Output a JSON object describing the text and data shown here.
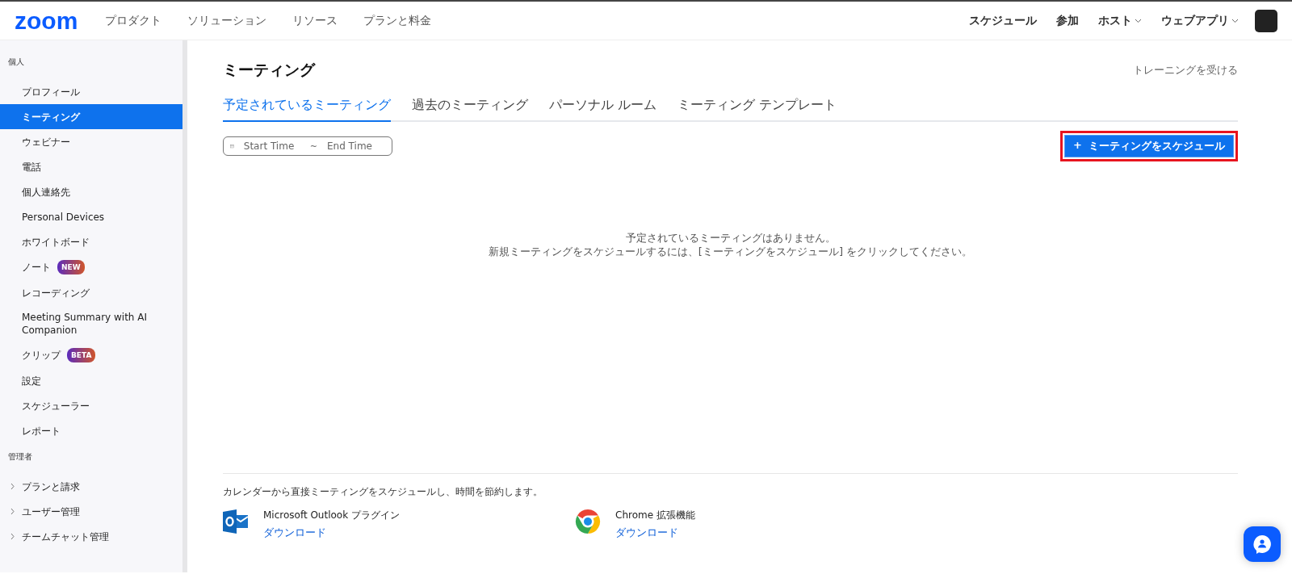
{
  "header": {
    "logo": "zoom",
    "nav": [
      "プロダクト",
      "ソリューション",
      "リソース",
      "プランと料金"
    ],
    "right_nav": [
      {
        "label": "スケジュール",
        "dropdown": false
      },
      {
        "label": "参加",
        "dropdown": false
      },
      {
        "label": "ホスト",
        "dropdown": true
      },
      {
        "label": "ウェブアプリ",
        "dropdown": true
      }
    ]
  },
  "sidebar": {
    "sections": [
      {
        "title": "個人",
        "items": [
          {
            "label": "プロフィール",
            "selected": false
          },
          {
            "label": "ミーティング",
            "selected": true
          },
          {
            "label": "ウェビナー",
            "selected": false
          },
          {
            "label": "電話",
            "selected": false
          },
          {
            "label": "個人連絡先",
            "selected": false
          },
          {
            "label": "Personal Devices",
            "selected": false
          },
          {
            "label": "ホワイトボード",
            "selected": false
          },
          {
            "label": "ノート",
            "selected": false,
            "badge": "NEW"
          },
          {
            "label": "レコーディング",
            "selected": false
          },
          {
            "label": "Meeting Summary with AI Companion",
            "selected": false
          },
          {
            "label": "クリップ",
            "selected": false,
            "badge": "BETA"
          },
          {
            "label": "設定",
            "selected": false
          },
          {
            "label": "スケジューラー",
            "selected": false
          },
          {
            "label": "レポート",
            "selected": false
          }
        ]
      },
      {
        "title": "管理者",
        "items": [
          {
            "label": "プランと請求",
            "selected": false,
            "expandable": true
          },
          {
            "label": "ユーザー管理",
            "selected": false,
            "expandable": true
          },
          {
            "label": "チームチャット管理",
            "selected": false,
            "expandable": true
          }
        ]
      }
    ]
  },
  "main": {
    "title": "ミーティング",
    "training_link": "トレーニングを受ける",
    "tabs": [
      {
        "label": "予定されているミーティング",
        "selected": true
      },
      {
        "label": "過去のミーティング",
        "selected": false
      },
      {
        "label": "パーソナル ルーム",
        "selected": false
      },
      {
        "label": "ミーティング テンプレート",
        "selected": false
      }
    ],
    "date_range": {
      "start_placeholder": "Start Time",
      "separator": "~",
      "end_placeholder": "End Time"
    },
    "schedule_button": {
      "icon": "+",
      "label": "ミーティングをスケジュール",
      "highlighted": true
    },
    "empty_message": [
      "予定されているミーティングはありません。",
      "新規ミーティングをスケジュールするには、[ミーティングをスケジュール] をクリックしてください。"
    ],
    "calendar_note": "カレンダーから直接ミーティングをスケジュールし、時間を節約します。",
    "plugins": [
      {
        "kind": "outlook",
        "name": "Microsoft Outlook プラグイン",
        "link": "ダウンロード"
      },
      {
        "kind": "chrome",
        "name": "Chrome 拡張機能",
        "link": "ダウンロード"
      }
    ]
  }
}
